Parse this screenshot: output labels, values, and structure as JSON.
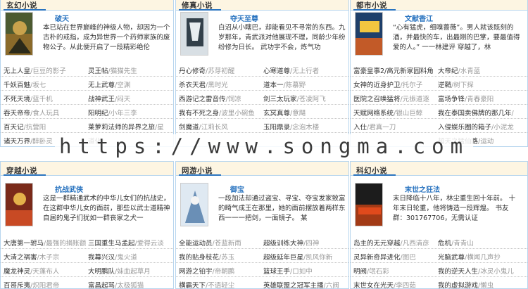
{
  "panels": [
    {
      "title": "玄幻小说",
      "feature": {
        "title": "破天",
        "desc": "本已站在世界巅峰的神级人物，却因为一个古朴的戒指，成为异世界一个药师家族的废物公子。从此便开启了一段精彩绝伦"
      },
      "rows": [
        [
          [
            "无上人皇",
            "/巨豆的影子"
          ],
          [
            "灵王帖",
            "/猫猫先生"
          ]
        ],
        [
          [
            "千妖百魅",
            "/坂七"
          ],
          [
            "无上武尊",
            "/空渊"
          ]
        ],
        [
          [
            "不死天境",
            "/蓝千机"
          ],
          [
            "战神武王",
            "/闷天"
          ]
        ],
        [
          [
            "吞天帝帝",
            "/食人玩具"
          ],
          [
            "阳明纪",
            "/小年三李"
          ]
        ],
        [
          [
            "百天记",
            "/抗营阳"
          ],
          [
            "莱萝莉法师的异界之旅",
            "/星"
          ]
        ],
        [
          [
            "诸天万界",
            "/醉卧灵"
          ],
          [
            "道化",
            "/"
          ]
        ]
      ]
    },
    {
      "title": "修真小说",
      "feature": {
        "title": "夺天至尊",
        "desc": "白沼从小瞎巴，却能看见不寻常的东西。九岁那年，青武派对他展现不理，同龄少年纷纷修为日长。 武功宇不会，炼气功"
      },
      "rows": [
        [
          [
            "丹心修奇",
            "/苏芽初醒"
          ],
          [
            "心寒道尊",
            "/无上行者"
          ]
        ],
        [
          [
            "杀衣天君",
            "/黑时光"
          ],
          [
            "道本一",
            "/陈慕野"
          ]
        ],
        [
          [
            "西游记之雷音传",
            "/饲凉"
          ],
          [
            "剑三太玩家",
            "/苍凌阿飞"
          ]
        ],
        [
          [
            "我有不死之身",
            "/波里小碗鱼"
          ],
          [
            "玄冥真尊",
            "/意飓"
          ]
        ],
        [
          [
            "剑魔道",
            "/江莉长风"
          ],
          [
            "玉阳鼎录",
            "/念泡木楼"
          ]
        ],
        [
          [
            "",
            ""
          ],
          [
            "",
            ""
          ]
        ]
      ]
    },
    {
      "title": "都市小说",
      "feature": {
        "title": "文献香江",
        "desc": "“心有猛虎，细嗅蔷薇”。男人就该既刻的酒，并最快的车，出最刚的巴掌，要最值得爱的人。” 一一林建评 穿越了，林"
      },
      "rows": [
        [
          [
            "富豪皇事2/高元新家园料角",
            ""
          ],
          [
            "大帝纪",
            "/水青蓝"
          ]
        ],
        [
          [
            "女神的近身护卫",
            "/托尔子"
          ],
          [
            "逆鞘",
            "/树下探"
          ]
        ],
        [
          [
            "医院之召唤猛将",
            "/元振道逐"
          ],
          [
            "富场争锋",
            "/青春豪阳"
          ]
        ],
        [
          [
            "天赋网络系统",
            "/银山巨鲸"
          ],
          [
            "我在泰国卖佛牌的那几年",
            "/"
          ]
        ],
        [
          [
            "入仕",
            "/君真一刀"
          ],
          [
            "入侵娱乐圈的箱子",
            "/小泥龙"
          ]
        ],
        [
          [
            "",
            ""
          ],
          [
            "超天之猛仙路",
            "/运动"
          ]
        ]
      ]
    },
    {
      "title": "穿越小说",
      "feature": {
        "title": "抗战武侠",
        "desc": "这是一群精通武术的中华儿女们的抗战史，在这群中华儿女的面前，那些以武士道精神自居的鬼子们犹如一群丧家之犬一"
      },
      "rows": [
        [
          [
            "大唐第一驸马",
            "/最强的捐账额"
          ],
          [
            "三国重生马孟起",
            "/爱得云淡"
          ]
        ],
        [
          [
            "大清之祸害",
            "/木子宗"
          ],
          [
            "我幕兴汉",
            "/鬼火道"
          ]
        ],
        [
          [
            "魔龙神灵",
            "/天蓬布人"
          ],
          [
            "大明鹏队",
            "/妹血起草月"
          ]
        ],
        [
          [
            "百哥斥夷",
            "/炽阳君帝"
          ],
          [
            "富昌起骂",
            "/太极狐猫"
          ]
        ],
        [
          [
            "",
            ""
          ],
          [
            "",
            ""
          ]
        ],
        [
          [
            "",
            ""
          ],
          [
            "",
            ""
          ]
        ]
      ]
    },
    {
      "title": "网游小说",
      "feature": {
        "title": "御宝",
        "desc": "一段加法却通过盗宝、寻宝、夺宝发家致富的畸气成王在那里，她的面前摆放着两样东西一一一把剑，一面镜子。 某"
      },
      "rows": [
        [
          [
            "全能运动员",
            "/苍蓝新雨"
          ],
          [
            "超级训练大神",
            "/四神"
          ]
        ],
        [
          [
            "我的贴身枝花",
            "/苏玉"
          ],
          [
            "超级延年巨星",
            "/凯风你新"
          ]
        ],
        [
          [
            "网游之铂宇",
            "/帝朝鹏"
          ],
          [
            "篮球王手",
            "/口如中"
          ]
        ],
        [
          [
            "横霸天下",
            "/不语轻尘"
          ],
          [
            "英雄联盟之冠军主播",
            "/六阀"
          ]
        ],
        [
          [
            "",
            ""
          ],
          [
            "",
            ""
          ]
        ],
        [
          [
            "",
            ""
          ],
          [
            "",
            ""
          ]
        ]
      ]
    },
    {
      "title": "科幻小说",
      "feature": {
        "title": "末世之狂法",
        "desc": "末日降临十八年，林尘重生回十年前。 十年末日轮重，他将铸造一段辉煌。 书友群：301767706，无需认证"
      },
      "rows": [
        [
          [
            "岛主的无元穿越",
            "/凡西清彦"
          ],
          [
            "危机",
            "/青青山"
          ]
        ],
        [
          [
            "灵异新奇异进化",
            "/图巴"
          ],
          [
            "光脑武尊",
            "/横闻几声抄"
          ]
        ],
        [
          [
            "明阙",
            "/氓石彩"
          ],
          [
            "我的逆天人生",
            "/冰灵小鬼儿"
          ]
        ],
        [
          [
            "末世女在光天",
            "/李四茹"
          ],
          [
            "我的虚拟游戏",
            "/懒虫"
          ]
        ],
        [
          [
            "",
            ""
          ],
          [
            "",
            ""
          ]
        ],
        [
          [
            "",
            ""
          ],
          [
            "",
            ""
          ]
        ]
      ]
    }
  ],
  "watermark": "https://www.songma.com",
  "colors": {
    "accent": "#2a74c0",
    "border": "#b7d5ee",
    "header_bg": "#fdf5e2"
  },
  "icons": [
    "book-cover-image"
  ]
}
